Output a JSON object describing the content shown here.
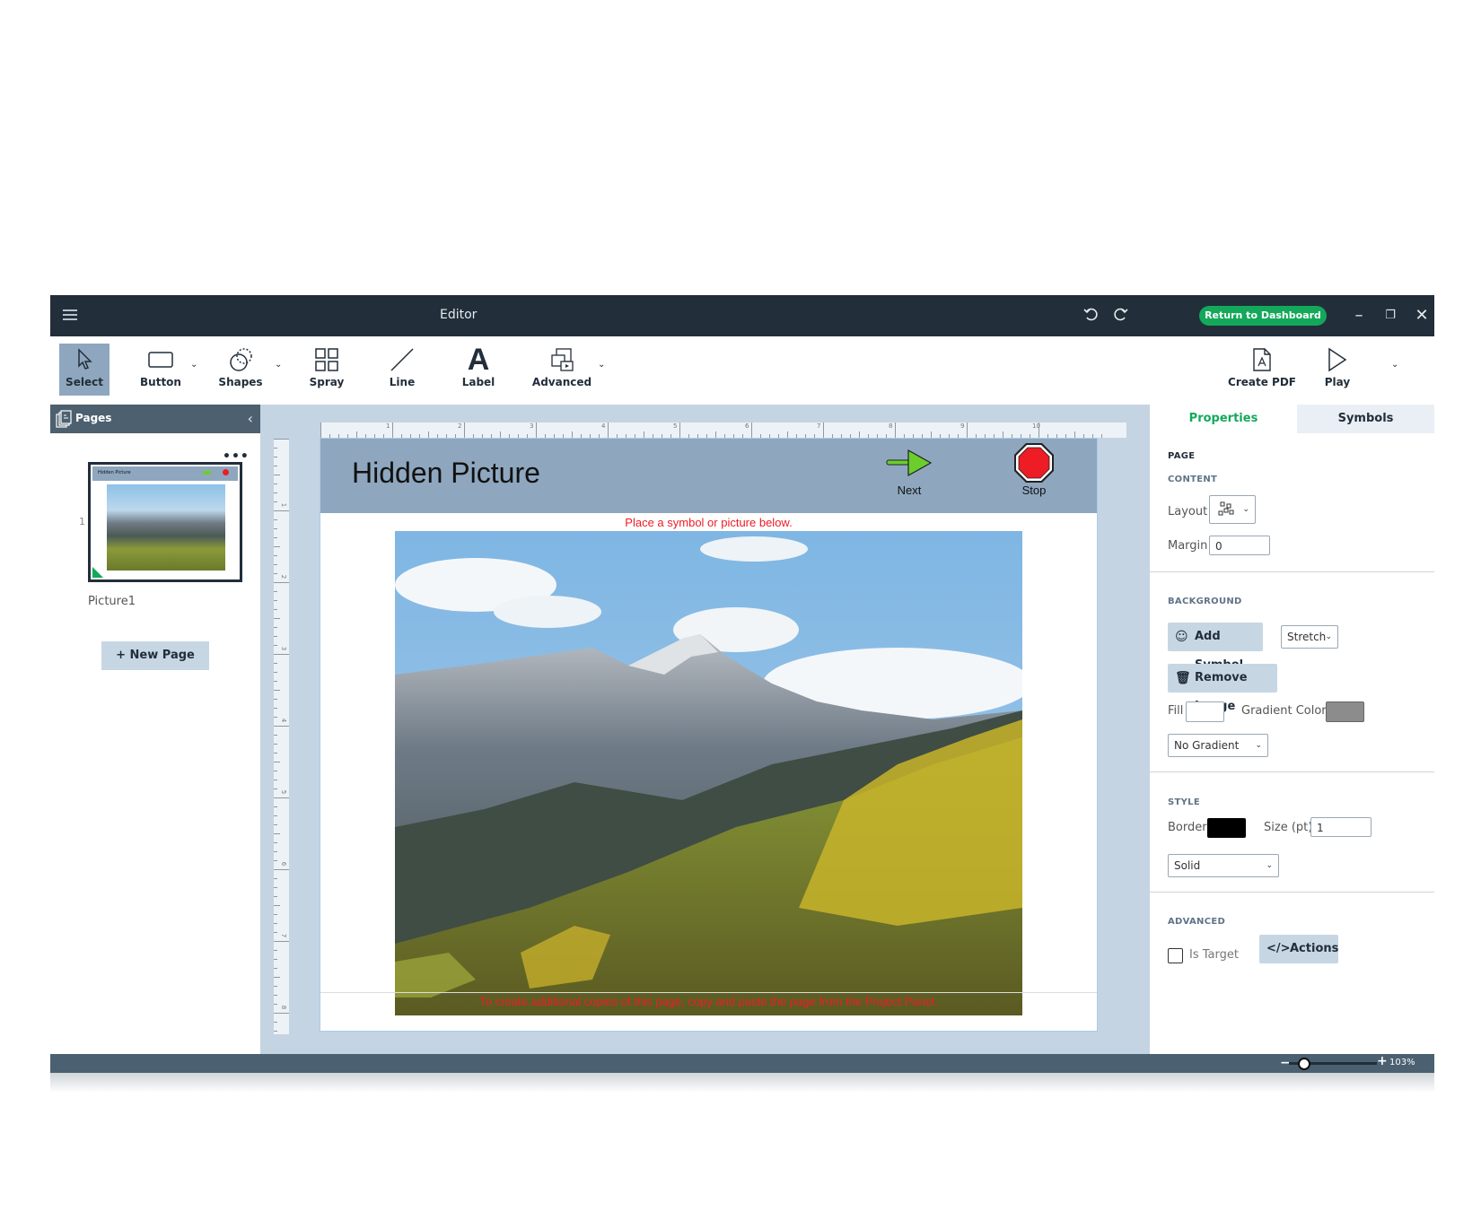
{
  "window": {
    "title": "Editor",
    "return_button": "Return to Dashboard",
    "accent_color": "#14a85a"
  },
  "toolbar": {
    "tools": [
      {
        "label": "Select",
        "icon": "cursor-icon",
        "active": true
      },
      {
        "label": "Button",
        "icon": "rectangle-icon",
        "has_dropdown": true
      },
      {
        "label": "Shapes",
        "icon": "shapes-icon",
        "has_dropdown": true
      },
      {
        "label": "Spray",
        "icon": "grid-icon"
      },
      {
        "label": "Line",
        "icon": "line-icon"
      },
      {
        "label": "Label",
        "icon": "text-a-icon"
      },
      {
        "label": "Advanced",
        "icon": "media-icon",
        "has_dropdown": true
      }
    ],
    "right_tools": [
      {
        "label": "Create PDF",
        "icon": "pdf-icon"
      },
      {
        "label": "Play",
        "icon": "play-icon",
        "has_dropdown": true
      }
    ]
  },
  "pages_panel": {
    "title": "Pages",
    "pages": [
      {
        "number": "1",
        "name": "Picture1",
        "thumb_title": "Hidden Picture"
      }
    ],
    "new_page_label": "+ New Page"
  },
  "canvas": {
    "ruler_h": [
      "1",
      "2",
      "3",
      "4",
      "5",
      "6",
      "7",
      "8",
      "9",
      "10"
    ],
    "ruler_v": [
      "1",
      "2",
      "3",
      "4",
      "5",
      "6",
      "7",
      "8"
    ],
    "page_title": "Hidden Picture",
    "buttons": [
      {
        "label": "Next",
        "icon": "green-arrow-right-icon"
      },
      {
        "label": "Stop",
        "icon": "stop-sign-icon"
      }
    ],
    "top_instruction": "Place a symbol or picture below.",
    "bottom_instruction": "To create additional copies of this page, copy and paste the page from the Project Panel.",
    "image_description": "Mountain landscape with snow-capped peak, clouds and yellow aspen trees"
  },
  "properties": {
    "tabs": [
      "Properties",
      "Symbols"
    ],
    "active_tab": "Properties",
    "page_label": "PAGE",
    "content": {
      "title": "CONTENT",
      "layout_label": "Layout",
      "margin_label": "Margin",
      "margin_value": "0"
    },
    "background": {
      "title": "BACKGROUND",
      "add_symbol": "Add Symbol",
      "stretch_value": "Stretch",
      "remove_image": "Remove Image",
      "fill_label": "Fill",
      "fill_color": "#ffffff",
      "gradient_label": "Gradient Color",
      "gradient_color": "#8c8c8c",
      "gradient_value": "No Gradient"
    },
    "style": {
      "title": "STYLE",
      "border_label": "Border",
      "border_color": "#000000",
      "size_label": "Size (pt)",
      "size_value": "1",
      "line_style": "Solid"
    },
    "advanced": {
      "title": "ADVANCED",
      "is_target_label": "Is Target",
      "is_target": false,
      "actions_label": "Actions"
    }
  },
  "status_bar": {
    "zoom_value": "103%",
    "zoom_minus": "−",
    "zoom_plus": "+"
  }
}
